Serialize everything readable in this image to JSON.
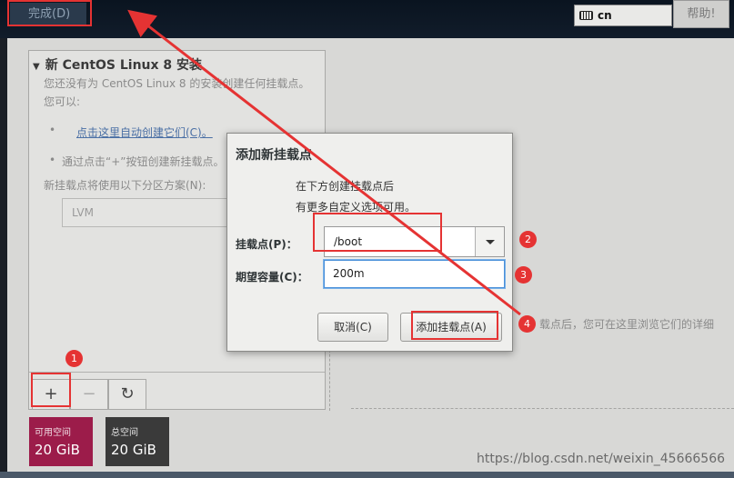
{
  "header": {
    "done_label": "完成(D)",
    "keyboard_layout": "cn",
    "help_label": "帮助!"
  },
  "left_panel": {
    "title": "新 CentOS Linux 8 安装",
    "line1": "您还没有为 CentOS Linux 8 的安装创建任何挂载点。",
    "line2": "您可以:",
    "auto_create_link": "点击这里自动创建它们(C)。",
    "line_manual": "通过点击“+”按钮创建新挂载点。",
    "scheme_label": "新挂载点将使用以下分区方案(N):",
    "scheme_value": "LVM",
    "add_icon": "+",
    "remove_icon": "−",
    "refresh_icon": "↻"
  },
  "space": {
    "available_label": "可用空间",
    "available_value": "20 GiB",
    "total_label": "总空间",
    "total_value": "20 GiB",
    "available_color": "#9c1c4a",
    "total_color": "#3a3a3a"
  },
  "right_hint": "载点后，您可在这里浏览它们的详细",
  "dialog": {
    "title": "添加新挂载点",
    "desc_line1": "在下方创建挂载点后",
    "desc_line2": "有更多自定义选项可用。",
    "mount_label": "挂载点(P)：",
    "mount_value": "/boot",
    "capacity_label": "期望容量(C)：",
    "capacity_value": "200m",
    "cancel_label": "取消(C)",
    "add_label": "添加挂载点(A)"
  },
  "annotations": {
    "badge1": "1",
    "badge2": "2",
    "badge3": "3",
    "badge4": "4",
    "color": "#e53333"
  },
  "watermark": "https://blog.csdn.net/weixin_45666566"
}
